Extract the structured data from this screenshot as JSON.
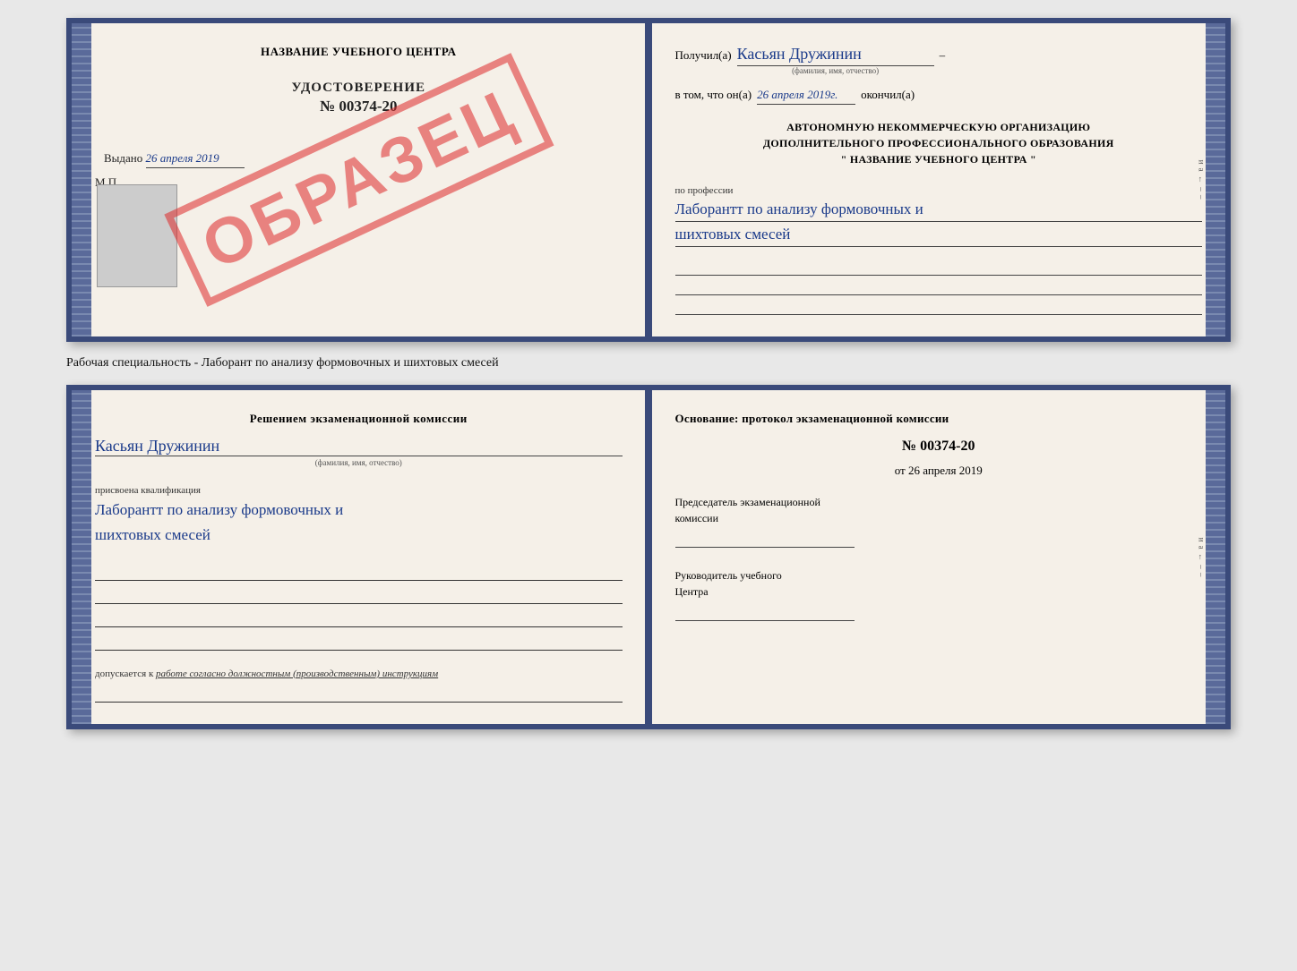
{
  "top_cert": {
    "left": {
      "title": "НАЗВАНИЕ УЧЕБНОГО ЦЕНТРА",
      "obrazec": "ОБРАЗЕЦ",
      "udostoverenie_label": "УДОСТОВЕРЕНИЕ",
      "number": "№ 00374-20",
      "vydano": "Выдано",
      "vydano_date": "26 апреля 2019",
      "mp": "М.П."
    },
    "right": {
      "poluchil_label": "Получил(а)",
      "recipient_name": "Касьян Дружинин",
      "fio_hint": "(фамилия, имя, отчество)",
      "dash": "–",
      "vtom_label": "в том, что он(а)",
      "date": "26 апреля 2019г.",
      "okonchil_label": "окончил(а)",
      "org_line1": "АВТОНОМНУЮ НЕКОММЕРЧЕСКУЮ ОРГАНИЗАЦИЮ",
      "org_line2": "ДОПОЛНИТЕЛЬНОГО ПРОФЕССИОНАЛЬНОГО ОБРАЗОВАНИЯ",
      "org_line3": "\"    НАЗВАНИЕ УЧЕБНОГО ЦЕНТРА    \"",
      "po_professii_label": "по профессии",
      "profession_line1": "Лаборантт по анализу формовочных и",
      "profession_line2": "шихтовых смесей"
    }
  },
  "specialty_label": "Рабочая специальность - Лаборант по анализу формовочных и шихтовых смесей",
  "bottom_cert": {
    "left": {
      "resheniem_title": "Решением экзаменационной комиссии",
      "komissia_name": "Касьян Дружинин",
      "fio_hint": "(фамилия, имя, отчество)",
      "prisvoena_label": "присвоена квалификация",
      "qualification_line1": "Лаборантт по анализу формовочных и",
      "qualification_line2": "шихтовых смесей",
      "dopuskaetsya_label": "допускается к",
      "dopuskaetsya_value": "работе согласно должностным (производственным) инструкциям"
    },
    "right": {
      "osnovanie_title": "Основание: протокол экзаменационной комиссии",
      "protocol_number": "№  00374-20",
      "ot_label": "от",
      "ot_date": "26 апреля 2019",
      "predsedatel_line1": "Председатель экзаменационной",
      "predsedatel_line2": "комиссии",
      "rukovoditel_line1": "Руководитель учебного",
      "rukovoditel_line2": "Центра"
    }
  }
}
